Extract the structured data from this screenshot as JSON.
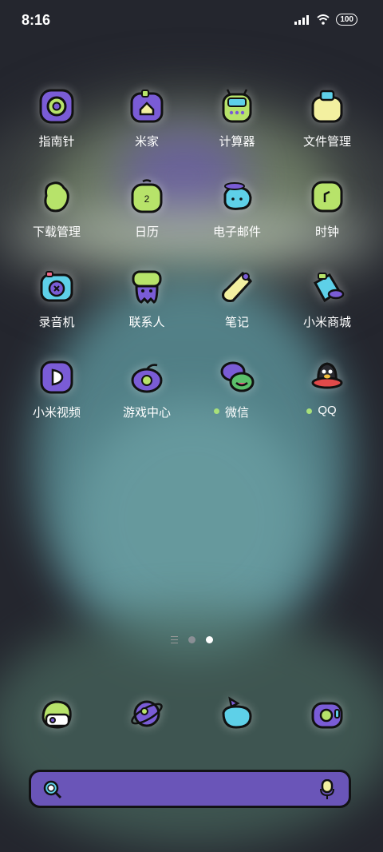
{
  "status_bar": {
    "time": "8:16",
    "battery": "100"
  },
  "apps": [
    {
      "label": "指南针",
      "icon": "compass-icon",
      "dot": false
    },
    {
      "label": "米家",
      "icon": "mijia-icon",
      "dot": false
    },
    {
      "label": "计算器",
      "icon": "calculator-icon",
      "dot": false
    },
    {
      "label": "文件管理",
      "icon": "file-manager-icon",
      "dot": false
    },
    {
      "label": "下载管理",
      "icon": "download-manager-icon",
      "dot": false
    },
    {
      "label": "日历",
      "icon": "calendar-icon",
      "dot": false
    },
    {
      "label": "电子邮件",
      "icon": "email-icon",
      "dot": false
    },
    {
      "label": "时钟",
      "icon": "clock-icon",
      "dot": false
    },
    {
      "label": "录音机",
      "icon": "recorder-icon",
      "dot": false
    },
    {
      "label": "联系人",
      "icon": "contacts-icon",
      "dot": false
    },
    {
      "label": "笔记",
      "icon": "notes-icon",
      "dot": false
    },
    {
      "label": "小米商城",
      "icon": "mi-store-icon",
      "dot": false
    },
    {
      "label": "小米视频",
      "icon": "mi-video-icon",
      "dot": false
    },
    {
      "label": "游戏中心",
      "icon": "game-center-icon",
      "dot": false
    },
    {
      "label": "微信",
      "icon": "wechat-icon",
      "dot": true
    },
    {
      "label": "QQ",
      "icon": "qq-icon",
      "dot": true
    }
  ],
  "pager": {
    "pages": 2,
    "active": 2
  },
  "dock": [
    {
      "icon": "phone-icon"
    },
    {
      "icon": "browser-icon"
    },
    {
      "icon": "messages-icon"
    },
    {
      "icon": "camera-icon"
    }
  ],
  "colors": {
    "accent_purple": "#6a55b8",
    "accent_green": "#a8e07a",
    "accent_yellow": "#f3f0a0",
    "accent_cyan": "#5ed0e8"
  }
}
